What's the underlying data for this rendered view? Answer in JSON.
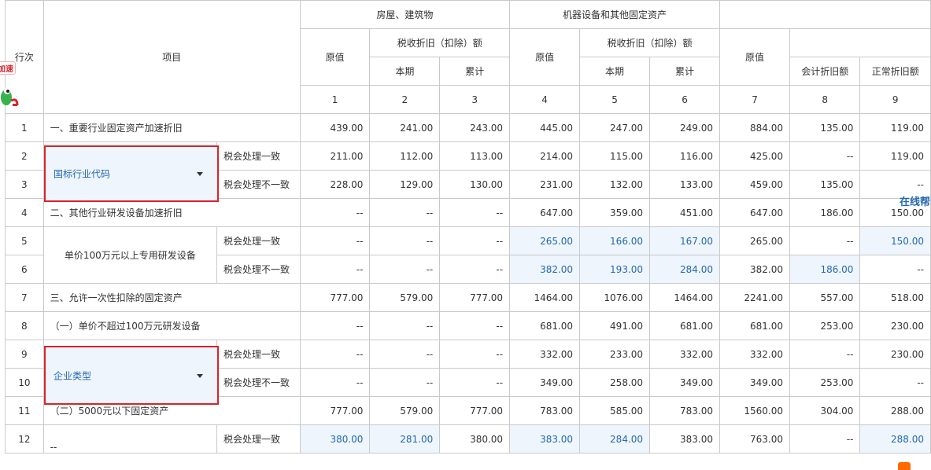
{
  "header": {
    "row_no": "行次",
    "item": "项目",
    "group_buildings": "房屋、建筑物",
    "group_machinery": "机器设备和其他固定资产",
    "original_value": "原值",
    "tax_depreciation": "税收折旧（扣除）额",
    "current_period": "本期",
    "cumulative": "累计",
    "accounting_depreciation": "会计折旧额",
    "normal_depreciation": "正常折旧额",
    "col_numbers": [
      "1",
      "2",
      "3",
      "4",
      "5",
      "6",
      "7",
      "8",
      "9"
    ]
  },
  "rows": [
    {
      "no": "1",
      "label": "一、重要行业固定资产加速折旧",
      "values": [
        "439.00",
        "241.00",
        "243.00",
        "445.00",
        "247.00",
        "249.00",
        "884.00",
        "135.00",
        "119.00"
      ]
    },
    {
      "no": "2",
      "sublabel": "税会处理一致",
      "values": [
        "211.00",
        "112.00",
        "113.00",
        "214.00",
        "115.00",
        "116.00",
        "425.00",
        "--",
        "119.00"
      ]
    },
    {
      "no": "3",
      "sublabel": "税会处理不一致",
      "values": [
        "228.00",
        "129.00",
        "130.00",
        "231.00",
        "132.00",
        "133.00",
        "459.00",
        "135.00",
        "--"
      ]
    },
    {
      "no": "4",
      "label": "二、其他行业研发设备加速折旧",
      "values": [
        "--",
        "--",
        "--",
        "647.00",
        "359.00",
        "451.00",
        "647.00",
        "186.00",
        "150.00"
      ]
    },
    {
      "no": "5",
      "sublabel": "税会处理一致",
      "values": [
        "--",
        "--",
        "--",
        "265.00",
        "166.00",
        "167.00",
        "265.00",
        "--",
        "150.00"
      ]
    },
    {
      "no": "6",
      "sublabel": "税会处理不一致",
      "values": [
        "--",
        "--",
        "--",
        "382.00",
        "193.00",
        "284.00",
        "382.00",
        "186.00",
        "--"
      ]
    },
    {
      "no": "7",
      "label": "三、允许一次性扣除的固定资产",
      "values": [
        "777.00",
        "579.00",
        "777.00",
        "1464.00",
        "1076.00",
        "1464.00",
        "2241.00",
        "557.00",
        "518.00"
      ]
    },
    {
      "no": "8",
      "label": "（一）单价不超过100万元研发设备",
      "values": [
        "--",
        "--",
        "--",
        "681.00",
        "491.00",
        "681.00",
        "681.00",
        "253.00",
        "230.00"
      ]
    },
    {
      "no": "9",
      "sublabel": "税会处理一致",
      "values": [
        "--",
        "--",
        "--",
        "332.00",
        "233.00",
        "332.00",
        "332.00",
        "--",
        "230.00"
      ]
    },
    {
      "no": "10",
      "sublabel": "税会处理不一致",
      "values": [
        "--",
        "--",
        "--",
        "349.00",
        "258.00",
        "349.00",
        "349.00",
        "253.00",
        "--"
      ]
    },
    {
      "no": "11",
      "label": "（二）5000元以下固定资产",
      "values": [
        "777.00",
        "579.00",
        "777.00",
        "783.00",
        "585.00",
        "783.00",
        "1560.00",
        "304.00",
        "288.00"
      ]
    },
    {
      "no": "12",
      "sublabel": "税会处理一致",
      "values": [
        "380.00",
        "281.00",
        "380.00",
        "383.00",
        "284.00",
        "383.00",
        "763.00",
        "--",
        "288.00"
      ]
    }
  ],
  "group_labels": {
    "rd_equipment_over_1m": "单价100万元以上专用研发设备",
    "row12_group": "--"
  },
  "dropdowns": {
    "industry_code": "国标行业代码",
    "enterprise_type": "企业类型"
  },
  "help_link": "在线帮",
  "mascot_badge": "加速"
}
